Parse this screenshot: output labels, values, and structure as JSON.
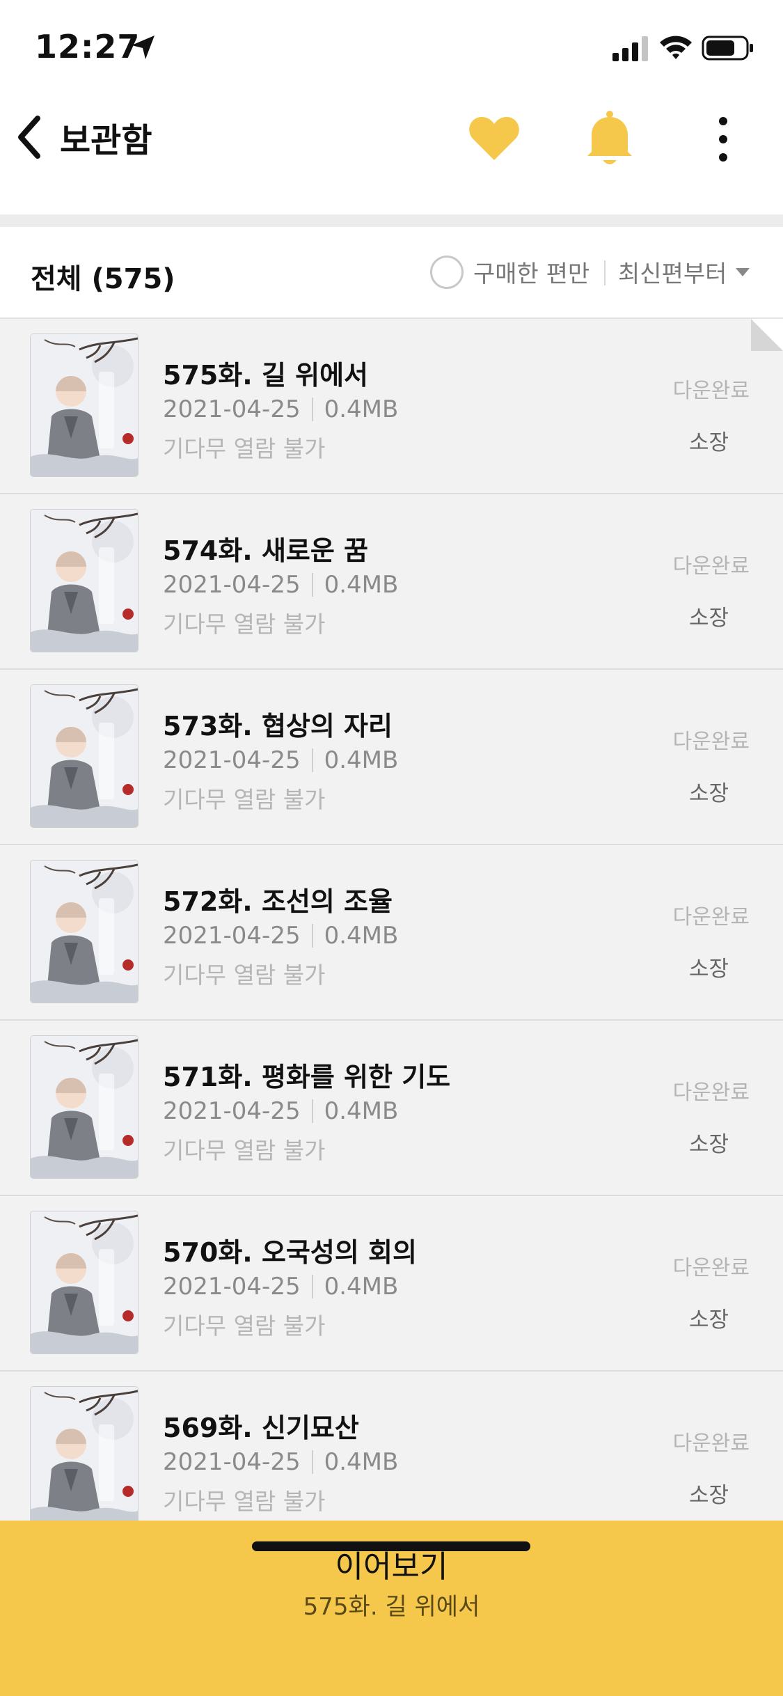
{
  "status_bar": {
    "time": "12:27",
    "icons": [
      "location-arrow-icon",
      "signal-icon",
      "wifi-icon",
      "battery-icon"
    ]
  },
  "header": {
    "title": "보관함",
    "icons": [
      "back-icon",
      "heart-icon",
      "bell-icon",
      "more-icon"
    ],
    "accent_color": "#F5C84C"
  },
  "filter_bar": {
    "total_label": "전체 (575)",
    "purchased_only_label": "구매한 편만",
    "sort_label": "최신편부터"
  },
  "episodes": [
    {
      "title": "575화. 길 위에서",
      "date": "2021-04-25",
      "size": "0.4MB",
      "note": "기다무 열람 불가",
      "download_status": "다운완료",
      "ownership": "소장"
    },
    {
      "title": "574화. 새로운 꿈",
      "date": "2021-04-25",
      "size": "0.4MB",
      "note": "기다무 열람 불가",
      "download_status": "다운완료",
      "ownership": "소장"
    },
    {
      "title": "573화. 협상의 자리",
      "date": "2021-04-25",
      "size": "0.4MB",
      "note": "기다무 열람 불가",
      "download_status": "다운완료",
      "ownership": "소장"
    },
    {
      "title": "572화. 조선의 조율",
      "date": "2021-04-25",
      "size": "0.4MB",
      "note": "기다무 열람 불가",
      "download_status": "다운완료",
      "ownership": "소장"
    },
    {
      "title": "571화. 평화를 위한 기도",
      "date": "2021-04-25",
      "size": "0.4MB",
      "note": "기다무 열람 불가",
      "download_status": "다운완료",
      "ownership": "소장"
    },
    {
      "title": "570화. 오국성의 회의",
      "date": "2021-04-25",
      "size": "0.4MB",
      "note": "기다무 열람 불가",
      "download_status": "다운완료",
      "ownership": "소장"
    },
    {
      "title": "569화. 신기묘산",
      "date": "2021-04-25",
      "size": "0.4MB",
      "note": "기다무 열람 불가",
      "download_status": "다운완료",
      "ownership": "소장"
    }
  ],
  "continue_bar": {
    "label": "이어보기",
    "episode": "575화. 길 위에서"
  }
}
